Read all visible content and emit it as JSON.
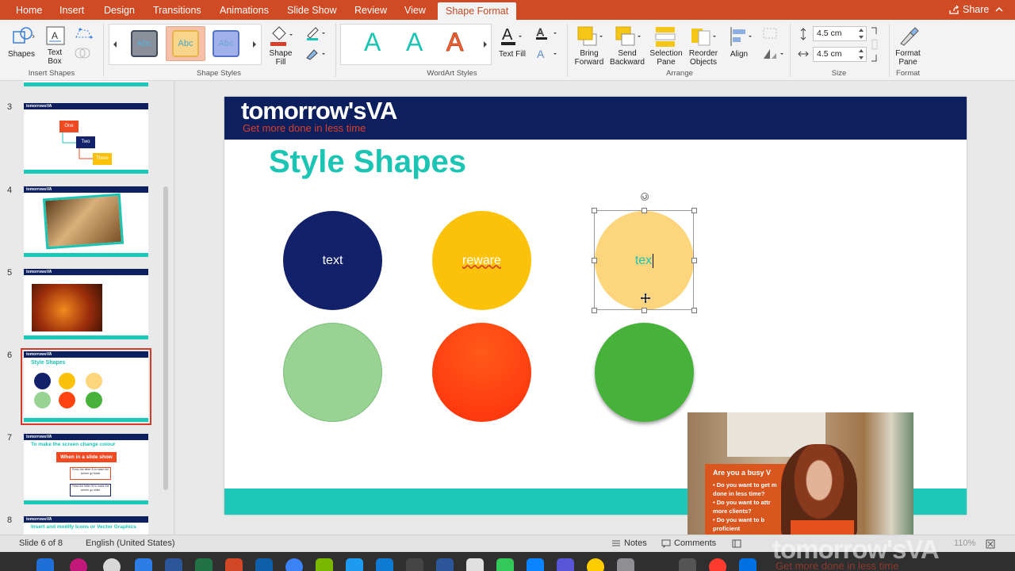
{
  "tabs": [
    "Home",
    "Insert",
    "Design",
    "Transitions",
    "Animations",
    "Slide Show",
    "Review",
    "View",
    "Shape Format"
  ],
  "active_tab": "Shape Format",
  "share_label": "Share",
  "ribbon": {
    "shapes_label": "Shapes",
    "textbox_label": "Text\nBox",
    "insert_shapes_group": "Insert Shapes",
    "style_preview_text": "Abc",
    "shape_styles_group": "Shape Styles",
    "shape_fill_label": "Shape\nFill",
    "wordart_letter": "A",
    "text_fill_label": "Text Fill",
    "wordart_group": "WordArt Styles",
    "bring_forward_label": "Bring\nForward",
    "send_backward_label": "Send\nBackward",
    "selection_pane_label": "Selection\nPane",
    "reorder_objects_label": "Reorder\nObjects",
    "align_label": "Align",
    "arrange_group": "Arrange",
    "height_value": "4.5 cm",
    "width_value": "4.5 cm",
    "size_group": "Size",
    "format_pane_label": "Format\nPane",
    "format_group": "Format"
  },
  "thumbnails": [
    {
      "num": "3",
      "brand": "tomorrowsVA",
      "nodes": [
        "One",
        "Two",
        "Three"
      ]
    },
    {
      "num": "4",
      "brand": "tomorrowsVA"
    },
    {
      "num": "5",
      "brand": "tomorrowsVA"
    },
    {
      "num": "6",
      "brand": "tomorrowsVA",
      "title": "Style Shapes"
    },
    {
      "num": "7",
      "brand": "tomorrowsVA",
      "title": "To make the screen change colour",
      "box": "When in a slide show",
      "sub1": "Press the letter B to make the screen go black",
      "sub2": "Press the letter W to make the screen go white"
    },
    {
      "num": "8",
      "brand": "tomorrowsVA",
      "title": "Insert and modify Icons or Vector Graphics"
    }
  ],
  "slide": {
    "brand": "tomorrow's",
    "brand_va": "VA",
    "tagline": "Get more done in less time",
    "title": "Style Shapes",
    "circles": [
      {
        "label": "text",
        "color": "#13206a"
      },
      {
        "label": "reware",
        "color": "#fcc20a"
      },
      {
        "label": "tex",
        "color": "#fcd57c"
      },
      {
        "label": "",
        "color": "#98d394"
      },
      {
        "label": "",
        "color": "#ff4413"
      },
      {
        "label": "",
        "color": "#46b23a"
      }
    ]
  },
  "webcam": {
    "poster_title": "Are you a busy V",
    "poster_lines": [
      "• Do you want to get m",
      "done in less time?",
      "• Do you want to attr",
      "more clients?",
      "• Do you want to b",
      "proficient "
    ]
  },
  "status": {
    "slide_info": "Slide 6 of 8",
    "language": "English (United States)",
    "notes": "Notes",
    "comments": "Comments",
    "zoom": "110%"
  },
  "watermark": {
    "brand": "tomorrow'sVA",
    "tagline": "Get more done in less time"
  },
  "colors": {
    "ribbon_tab_bar": "#d04a24",
    "slide_header": "#0d1f5c",
    "teal": "#1cc9b8",
    "accent_red": "#d9402c"
  }
}
